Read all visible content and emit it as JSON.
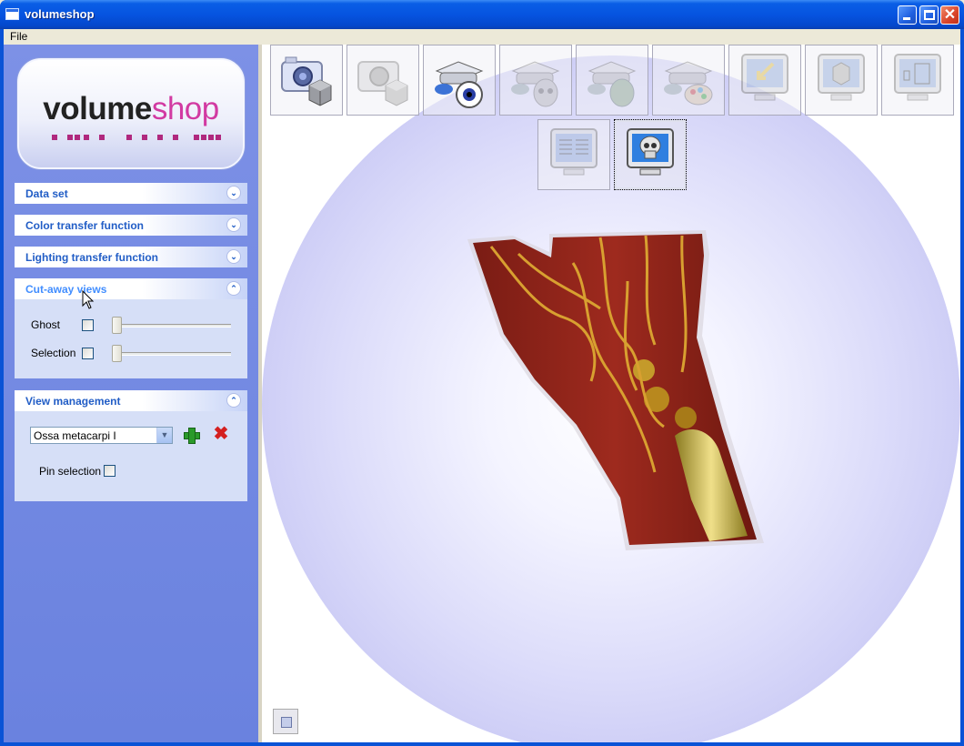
{
  "window": {
    "title": "volumeshop"
  },
  "menu": {
    "file": "File"
  },
  "logo": {
    "word_main": "volume",
    "word_accent": "shop"
  },
  "panels": {
    "data_set": {
      "title": "Data set",
      "state": "collapsed"
    },
    "color_tf": {
      "title": "Color transfer function",
      "state": "collapsed"
    },
    "lighting_tf": {
      "title": "Lighting transfer function",
      "state": "collapsed"
    },
    "cutaway": {
      "title": "Cut-away views",
      "state": "expanded",
      "ghost_label": "Ghost",
      "ghost_checked": false,
      "ghost_level": 0,
      "selection_label": "Selection",
      "selection_checked": false,
      "selection_level": 0
    },
    "view_mgmt": {
      "title": "View management",
      "state": "expanded",
      "view_value": "Ossa metacarpi I",
      "pin_label": "Pin selection",
      "pin_checked": false
    }
  },
  "toolbar": [
    {
      "name": "snapshot-volume-icon",
      "enabled": true
    },
    {
      "name": "snapshot-volume-disabled-icon",
      "enabled": false
    },
    {
      "name": "scanner-eye-icon",
      "enabled": true
    },
    {
      "name": "scanner-skull-icon",
      "enabled": false
    },
    {
      "name": "scanner-tissue-icon",
      "enabled": false
    },
    {
      "name": "scanner-palette-icon",
      "enabled": false
    },
    {
      "name": "monitor-import-icon",
      "enabled": false
    },
    {
      "name": "monitor-cube-icon",
      "enabled": false
    },
    {
      "name": "monitor-layout-icon",
      "enabled": false
    },
    {
      "name": "monitor-grid-icon",
      "enabled": false
    },
    {
      "name": "monitor-skull-icon",
      "enabled": true,
      "active": true
    }
  ],
  "colors": {
    "titlebar": "#0a5ee6",
    "sidebar": "#6a82df",
    "panel_title": "#215dc6",
    "viewport_sphere": "#c6c6f4",
    "logo_accent": "#d23aa2"
  }
}
